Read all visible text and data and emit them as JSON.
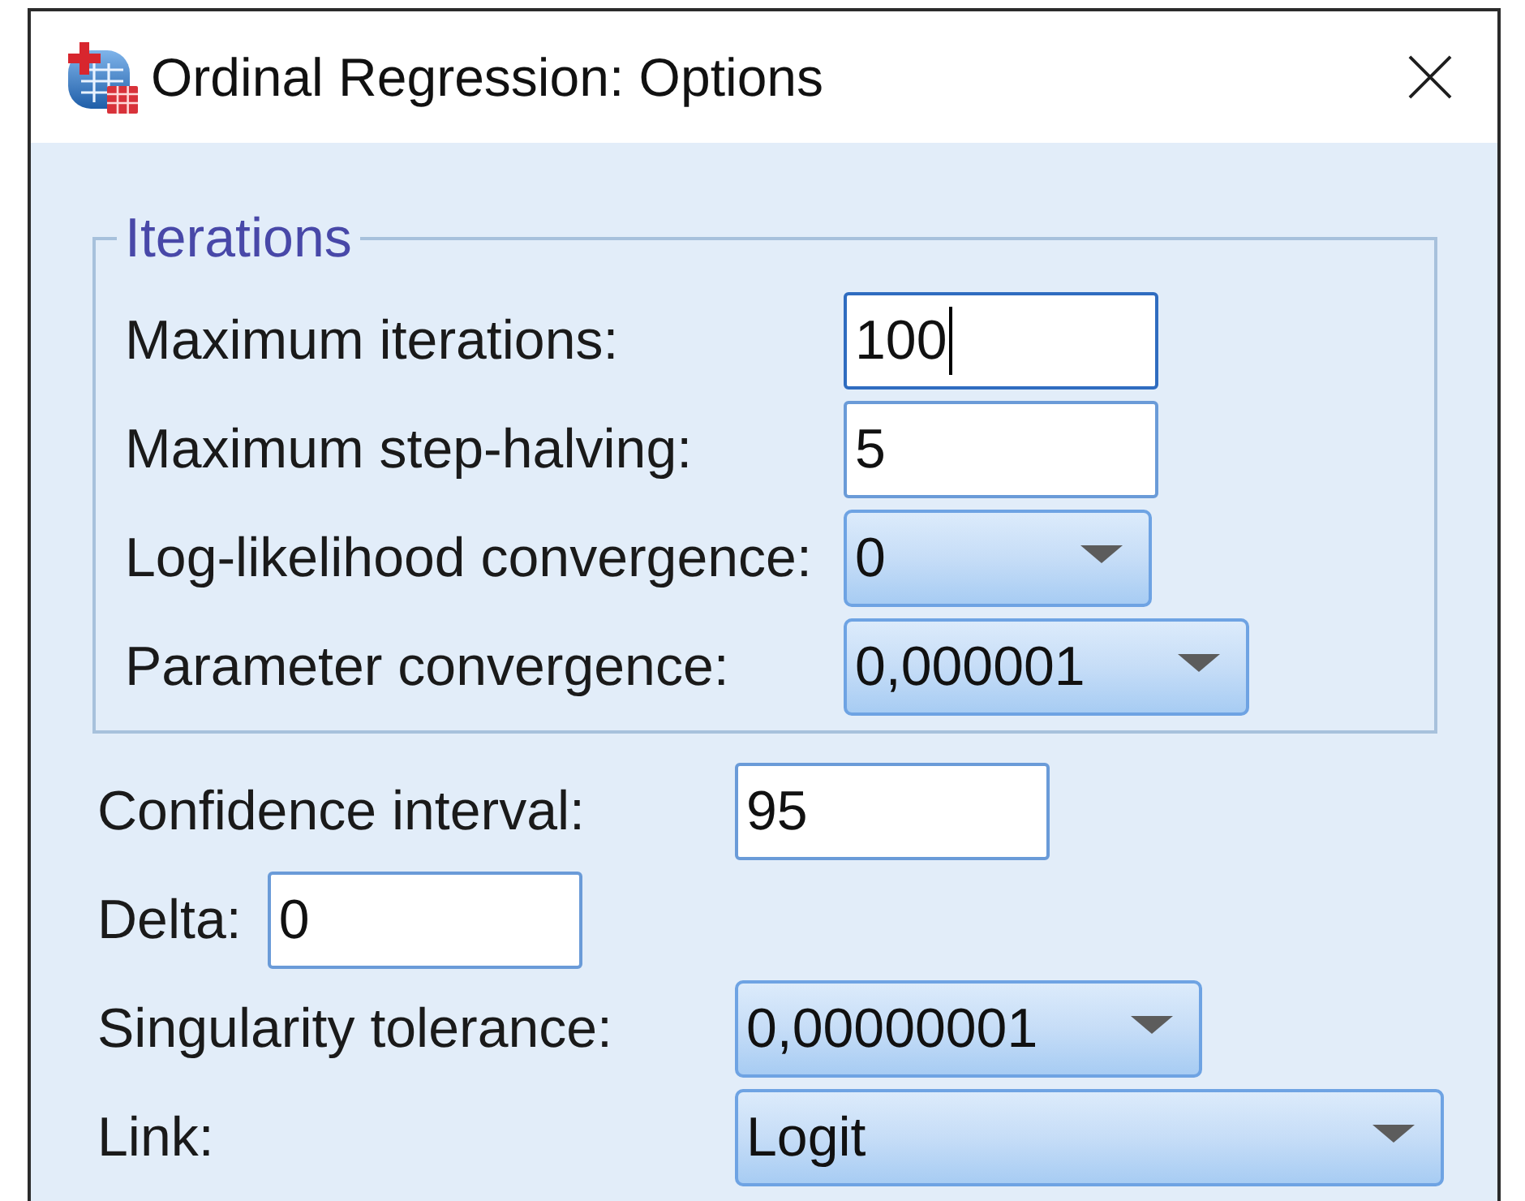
{
  "window": {
    "title": "Ordinal Regression: Options"
  },
  "iterations": {
    "title": "Iterations",
    "fields": [
      {
        "kind": "text",
        "label": "Maximum iterations:",
        "value": "100",
        "focused": true
      },
      {
        "kind": "text",
        "label": "Maximum step-halving:",
        "value": "5",
        "focused": false
      },
      {
        "kind": "dropdown",
        "label": "Log-likelihood convergence:",
        "value": "0"
      },
      {
        "kind": "dropdown",
        "label": "Parameter convergence:",
        "value": "0,000001"
      }
    ]
  },
  "fields": [
    {
      "kind": "text",
      "label": "Confidence interval:",
      "value": "95",
      "focused": false
    },
    {
      "kind": "text",
      "label": "Delta:",
      "value": "0",
      "focused": false
    },
    {
      "kind": "dropdown",
      "label": "Singularity tolerance:",
      "value": "0,00000001"
    },
    {
      "kind": "dropdown",
      "label": "Link:",
      "value": "Logit"
    }
  ]
}
